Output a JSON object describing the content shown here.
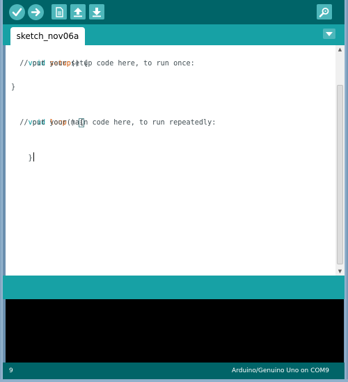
{
  "toolbar": {
    "buttons": [
      {
        "name": "verify",
        "icon": "check-icon"
      },
      {
        "name": "upload",
        "icon": "arrow-right-icon"
      },
      {
        "name": "new",
        "icon": "new-file-icon"
      },
      {
        "name": "open",
        "icon": "arrow-up-icon"
      },
      {
        "name": "save",
        "icon": "arrow-down-icon"
      },
      {
        "name": "serial-monitor",
        "icon": "magnifier-icon"
      }
    ]
  },
  "tab": {
    "label": "sketch_nov06a"
  },
  "code": {
    "line1_kw": "void",
    "line1_fn": "setup",
    "line1_rest": "() {",
    "line2": "  // put your setup code here, to run once:",
    "line3": "",
    "line4": "}",
    "line5": "",
    "line6_kw": "void",
    "line6_fn": "loop",
    "line6_rest": "() ",
    "line6_brace": "{",
    "line7": "  // put your main code here, to run repeatedly:",
    "line8": "",
    "line9": "}"
  },
  "status": {
    "line_number": "9",
    "board_port": "Arduino/Genuino Uno on COM9"
  },
  "colors": {
    "toolbar": "#006468",
    "tabbar": "#17a1a5",
    "button": "#4db7bb",
    "keyword": "#00979c",
    "function": "#d35400"
  }
}
